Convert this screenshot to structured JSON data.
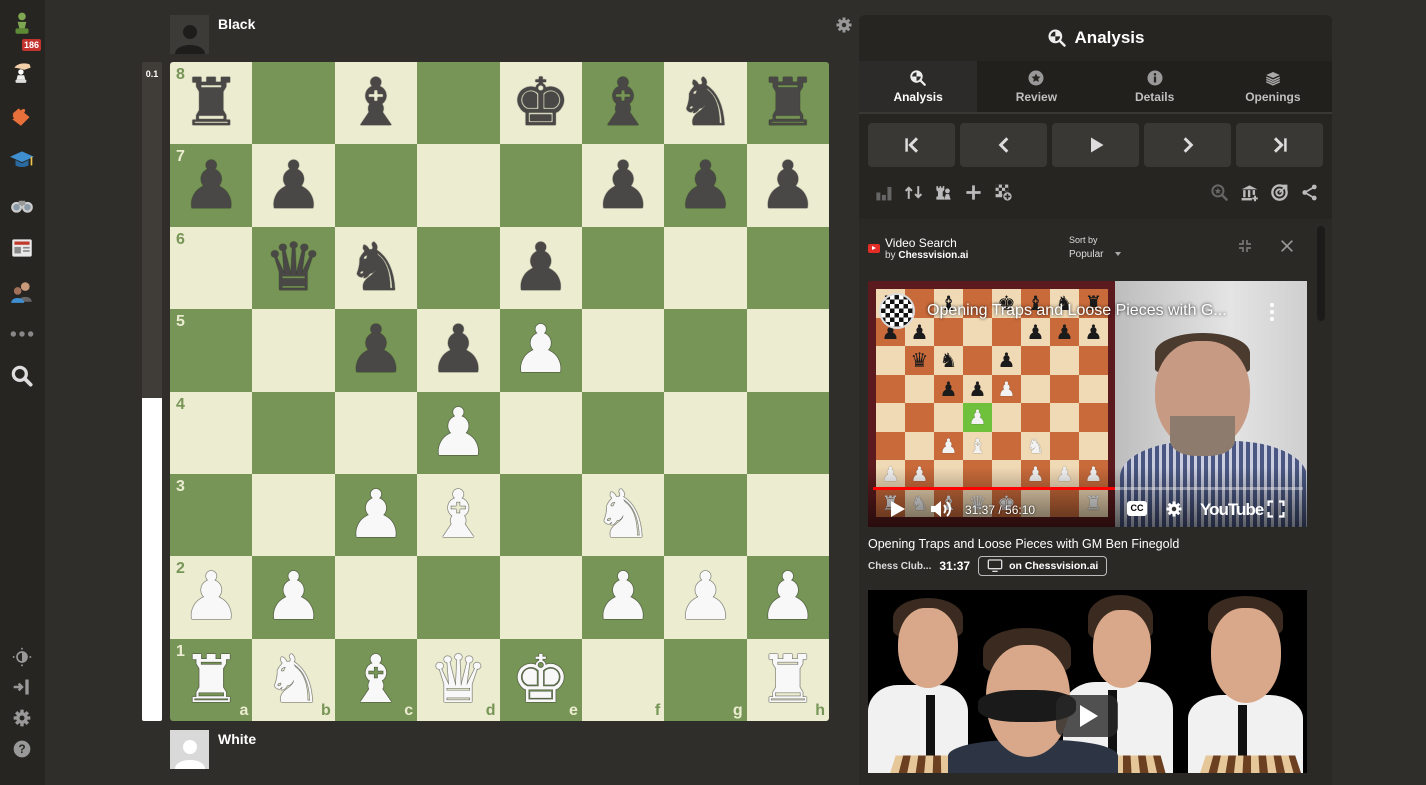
{
  "nav": {
    "items": [
      {
        "name": "play",
        "icon": "pawn-icon",
        "badge": "186"
      },
      {
        "name": "puzzles-hand",
        "icon": "hand-pawn-icon"
      },
      {
        "name": "puzzles",
        "icon": "puzzle-piece-icon"
      },
      {
        "name": "learn",
        "icon": "graduation-cap-icon"
      },
      {
        "name": "watch",
        "icon": "binoculars-icon"
      },
      {
        "name": "news",
        "icon": "newspaper-icon"
      },
      {
        "name": "social",
        "icon": "people-icon"
      },
      {
        "name": "more",
        "icon": "more-dots-icon"
      },
      {
        "name": "search",
        "icon": "search-icon"
      }
    ],
    "bottom": [
      {
        "name": "theme",
        "icon": "brightness-icon"
      },
      {
        "name": "collapse",
        "icon": "collapse-sidebar-icon"
      },
      {
        "name": "settings",
        "icon": "gear-icon"
      },
      {
        "name": "help",
        "icon": "help-icon"
      }
    ]
  },
  "players": {
    "top": "Black",
    "bottom": "White"
  },
  "eval": {
    "score": "0.1",
    "white_fraction": 0.49
  },
  "board": {
    "colors": {
      "light": "#ebecd0",
      "dark": "#779556"
    },
    "ranks": [
      "8",
      "7",
      "6",
      "5",
      "4",
      "3",
      "2",
      "1"
    ],
    "files": [
      "a",
      "b",
      "c",
      "d",
      "e",
      "f",
      "g",
      "h"
    ],
    "position": [
      [
        "bR",
        "",
        "bB",
        "",
        "bK",
        "bB",
        "bN",
        "bR"
      ],
      [
        "bP",
        "bP",
        "",
        "",
        "",
        "bP",
        "bP",
        "bP"
      ],
      [
        "",
        "bQ",
        "bN",
        "",
        "bP",
        "",
        "",
        ""
      ],
      [
        "",
        "",
        "bP",
        "bP",
        "wP",
        "",
        "",
        ""
      ],
      [
        "",
        "",
        "",
        "wP",
        "",
        "",
        "",
        ""
      ],
      [
        "",
        "",
        "wP",
        "wB",
        "",
        "wN",
        "",
        ""
      ],
      [
        "wP",
        "wP",
        "",
        "",
        "",
        "wP",
        "wP",
        "wP"
      ],
      [
        "wR",
        "wN",
        "wB",
        "wQ",
        "wK",
        "",
        "",
        "wR"
      ]
    ]
  },
  "panel": {
    "title": "Analysis",
    "tabs": [
      {
        "label": "Analysis",
        "icon": "analysis-icon",
        "active": true
      },
      {
        "label": "Review",
        "icon": "star-icon",
        "active": false
      },
      {
        "label": "Details",
        "icon": "info-icon",
        "active": false
      },
      {
        "label": "Openings",
        "icon": "book-stack-icon",
        "active": false
      }
    ],
    "controls": [
      "first-move",
      "previous-move",
      "play",
      "next-move",
      "last-move"
    ],
    "tools_left": [
      "bar-chart-icon",
      "flip-board-icon",
      "pieces-icon",
      "add-icon",
      "add-board-icon"
    ],
    "tools_right": [
      "explore-icon",
      "library-add-icon",
      "target-icon",
      "share-icon"
    ]
  },
  "video_search": {
    "title": "Video Search",
    "by_prefix": "by",
    "by_brand": "Chessvision.ai",
    "sort_label": "Sort by",
    "sort_value": "Popular",
    "videos": [
      {
        "title": "Opening Traps and Loose Pieces with GM Ben Finegold",
        "overlay_title": "Opening Traps and Loose Pieces with G...",
        "channel": "Chess Club...",
        "timestamp": "31:37",
        "player_time": "31:37 / 56:10",
        "progress": 0.563,
        "cc_label": "CC",
        "youtube_label": "YouTube",
        "link_label": "on Chessvision.ai"
      },
      {
        "title": "",
        "thumbnail": "four players at chessboards, one blindfolded"
      }
    ]
  }
}
